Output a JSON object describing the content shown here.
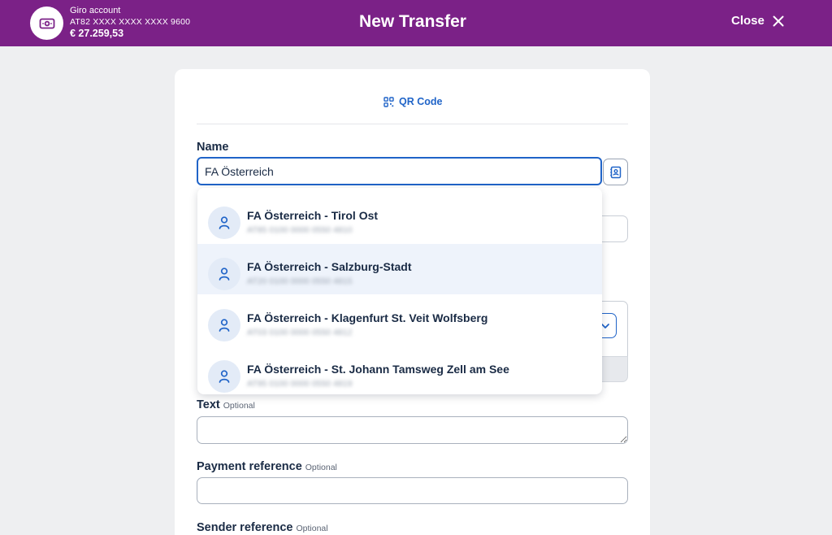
{
  "account": {
    "name": "Giro account",
    "iban": "AT82 XXXX XXXX XXXX 9600",
    "balance": "€ 27.259,53",
    "icon": "banknote-icon"
  },
  "header": {
    "title": "New Transfer",
    "close_label": "Close"
  },
  "qr": {
    "label": "QR Code",
    "icon": "qr-code-icon"
  },
  "form": {
    "name": {
      "label": "Name",
      "value": "FA Österreich"
    },
    "text": {
      "label": "Text",
      "optional": "Optional",
      "value": ""
    },
    "payment_reference": {
      "label": "Payment reference",
      "optional": "Optional",
      "value": ""
    },
    "sender_reference": {
      "label": "Sender reference",
      "optional": "Optional"
    }
  },
  "suggestions": [
    {
      "name": "FA Österreich - Tirol Ost",
      "iban": "AT85 0100 0000 0550 4810",
      "selected": false
    },
    {
      "name": "FA Österreich - Salzburg-Stadt",
      "iban": "AT20 0100 0000 0550 4815",
      "selected": true
    },
    {
      "name": "FA Österreich - Klagenfurt St. Veit Wolfsberg",
      "iban": "AT03 0100 0000 0550 4812",
      "selected": false
    },
    {
      "name": "FA Österreich - St. Johann Tamsweg Zell am See",
      "iban": "AT95 0100 0000 0550 4819",
      "selected": false
    }
  ],
  "colors": {
    "brand": "#7b2187",
    "accent": "#2064c8",
    "text": "#1a2b45",
    "highlight": "#eef3fb"
  }
}
